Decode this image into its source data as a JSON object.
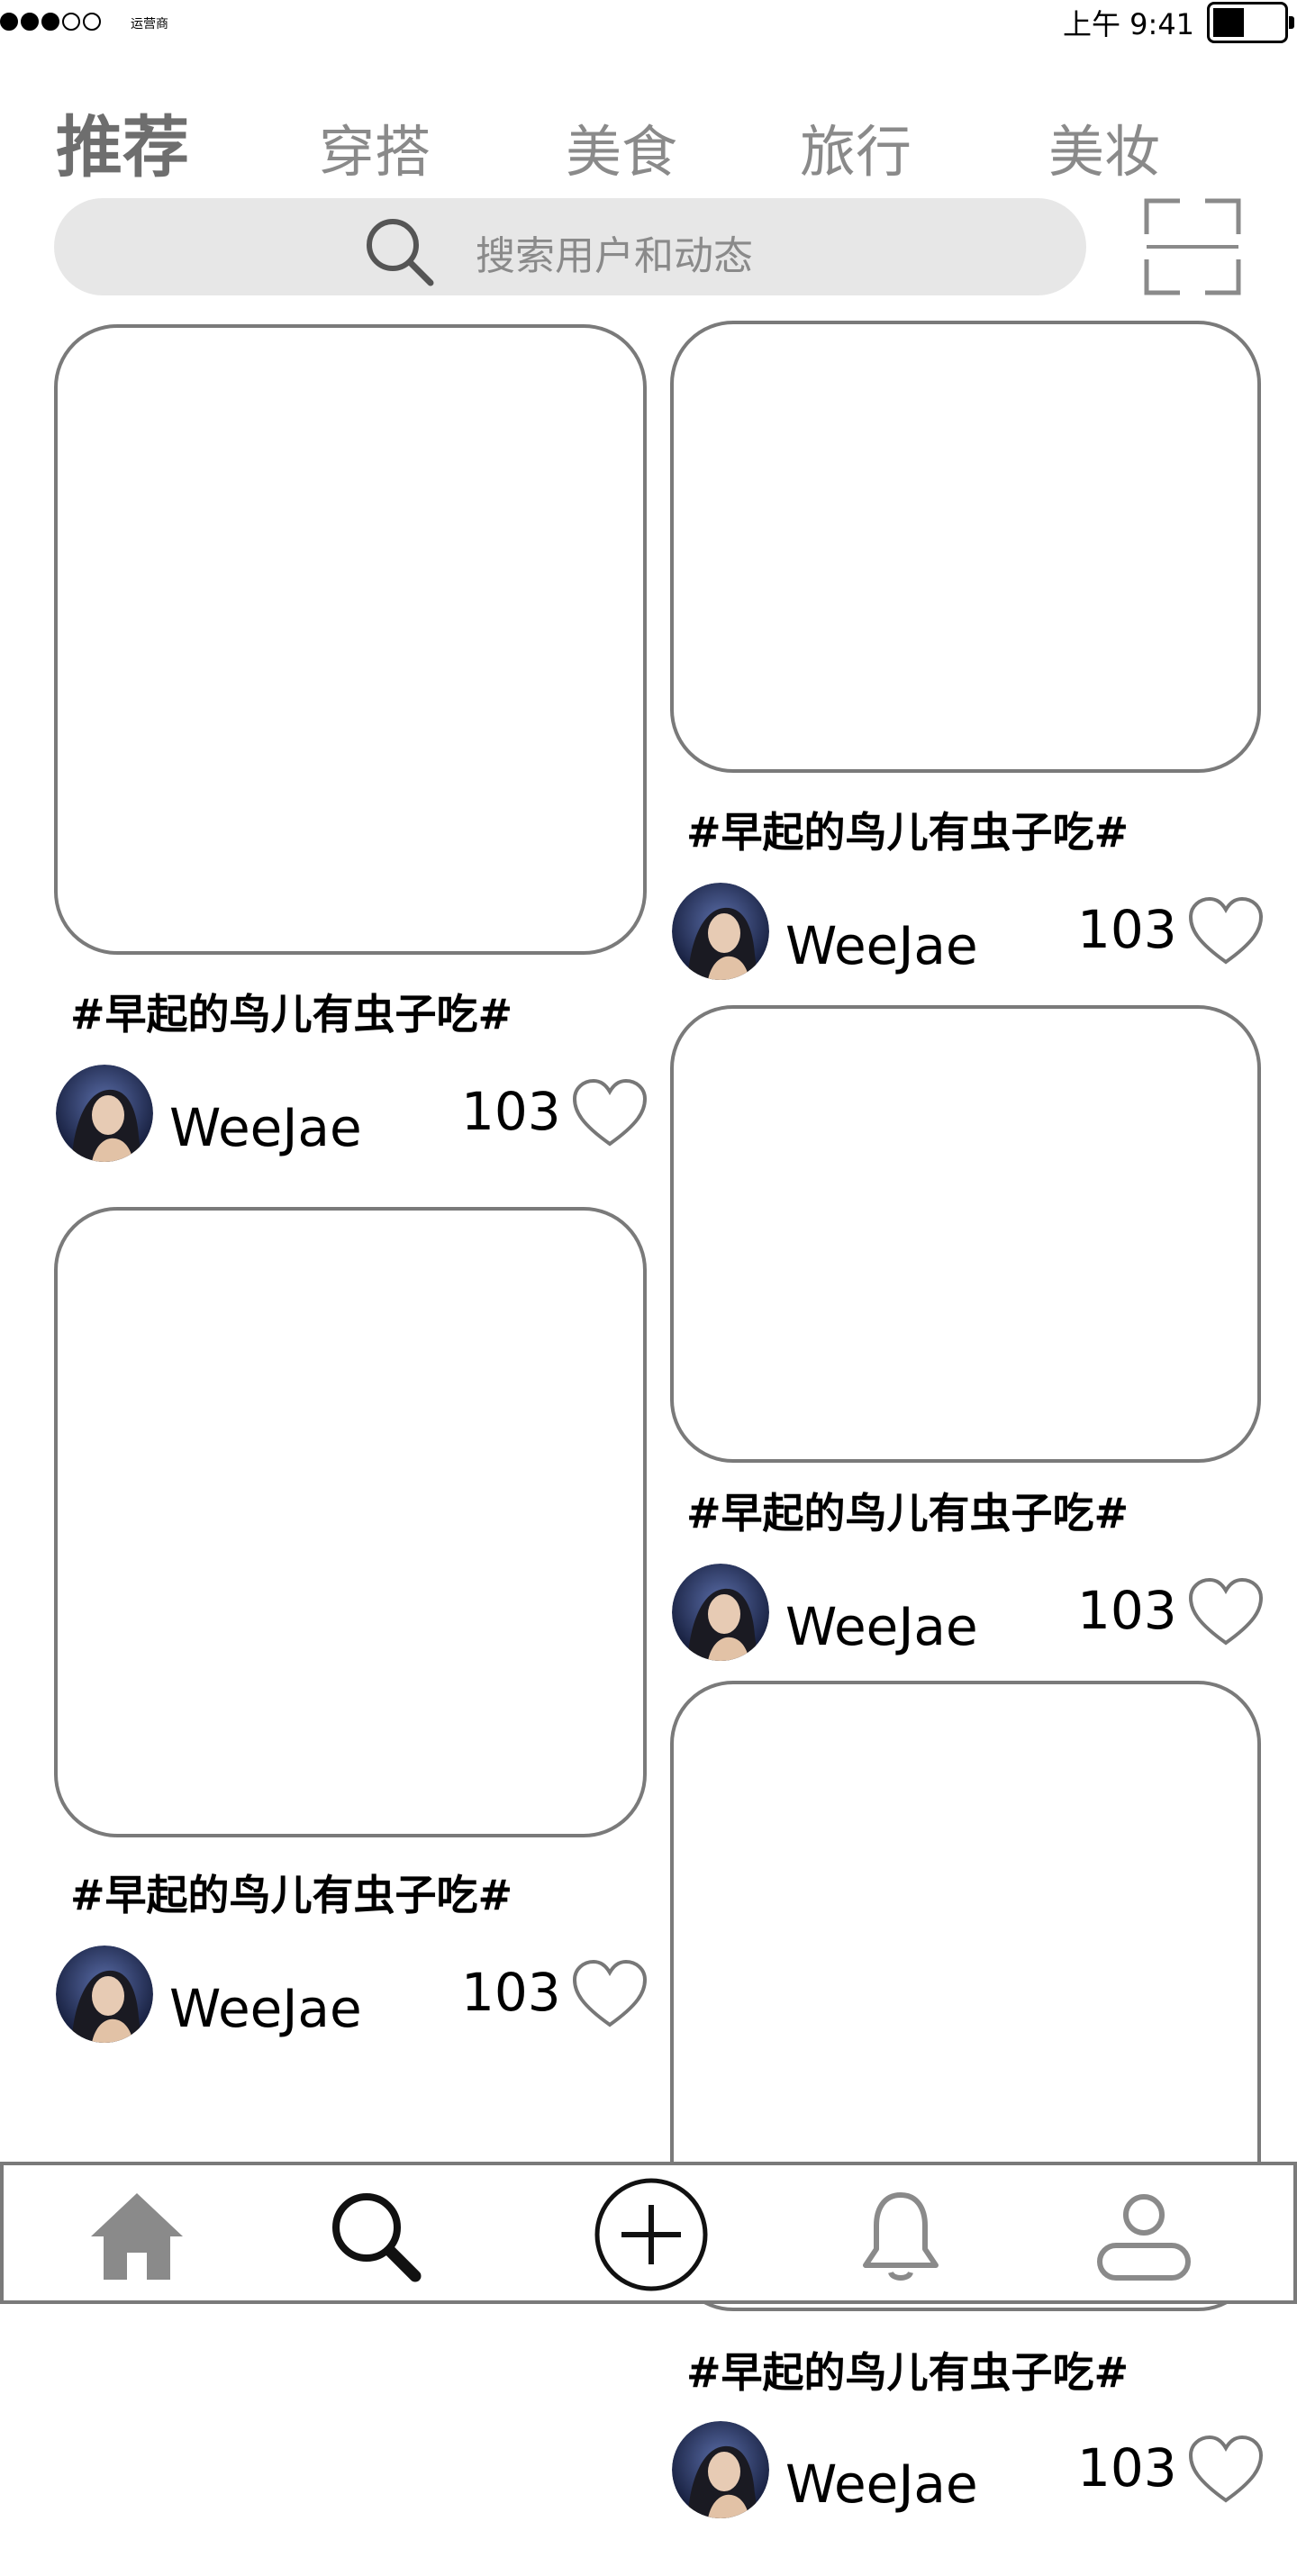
{
  "status_bar": {
    "carrier": "运营商",
    "time": "上午 9:41"
  },
  "tabs": [
    {
      "label": "推荐",
      "active": true
    },
    {
      "label": "穿搭",
      "active": false
    },
    {
      "label": "美食",
      "active": false
    },
    {
      "label": "旅行",
      "active": false
    },
    {
      "label": "美妆",
      "active": false
    }
  ],
  "search": {
    "placeholder": "搜索用户和动态"
  },
  "posts": [
    {
      "title": "#早起的鸟儿有虫子吃#",
      "author": "WeeJae",
      "likes": "103"
    },
    {
      "title": "#早起的鸟儿有虫子吃#",
      "author": "WeeJae",
      "likes": "103"
    },
    {
      "title": "#早起的鸟儿有虫子吃#",
      "author": "WeeJae",
      "likes": "103"
    },
    {
      "title": "#早起的鸟儿有虫子吃#",
      "author": "WeeJae",
      "likes": "103"
    },
    {
      "title": "#早起的鸟儿有虫子吃#",
      "author": "WeeJae",
      "likes": "103"
    }
  ],
  "bottom_nav": [
    {
      "icon": "home-icon"
    },
    {
      "icon": "search-icon"
    },
    {
      "icon": "add-icon"
    },
    {
      "icon": "bell-icon"
    },
    {
      "icon": "profile-icon"
    }
  ],
  "colors": {
    "accent_gray": "#7a7a7a",
    "search_bg": "#e7e7e7",
    "tab_inactive": "#8a8a8a"
  }
}
